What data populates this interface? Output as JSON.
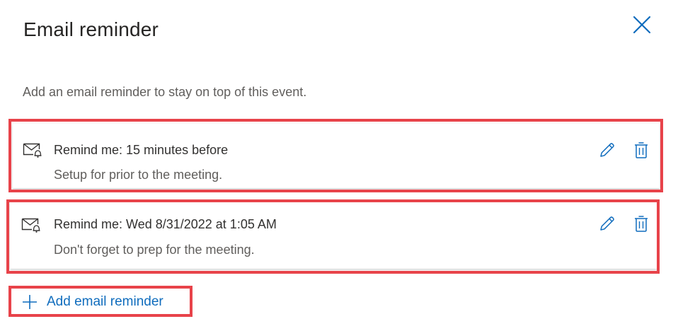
{
  "dialog": {
    "title": "Email reminder",
    "subtitle": "Add an email reminder to stay on top of this event."
  },
  "reminders": [
    {
      "title": "Remind me: 15 minutes before",
      "description": "Setup for prior to the meeting.",
      "icon": "email-reminder-icon"
    },
    {
      "title": "Remind me: Wed 8/31/2022 at 1:05 AM",
      "description": "Don't forget to prep for the meeting.",
      "icon": "email-reminder-icon"
    }
  ],
  "actions": {
    "add_label": "Add email reminder"
  },
  "colors": {
    "accent": "#0f6cbd",
    "highlight": "#e8434a",
    "text_primary": "#323130",
    "text_secondary": "#605e5c"
  }
}
